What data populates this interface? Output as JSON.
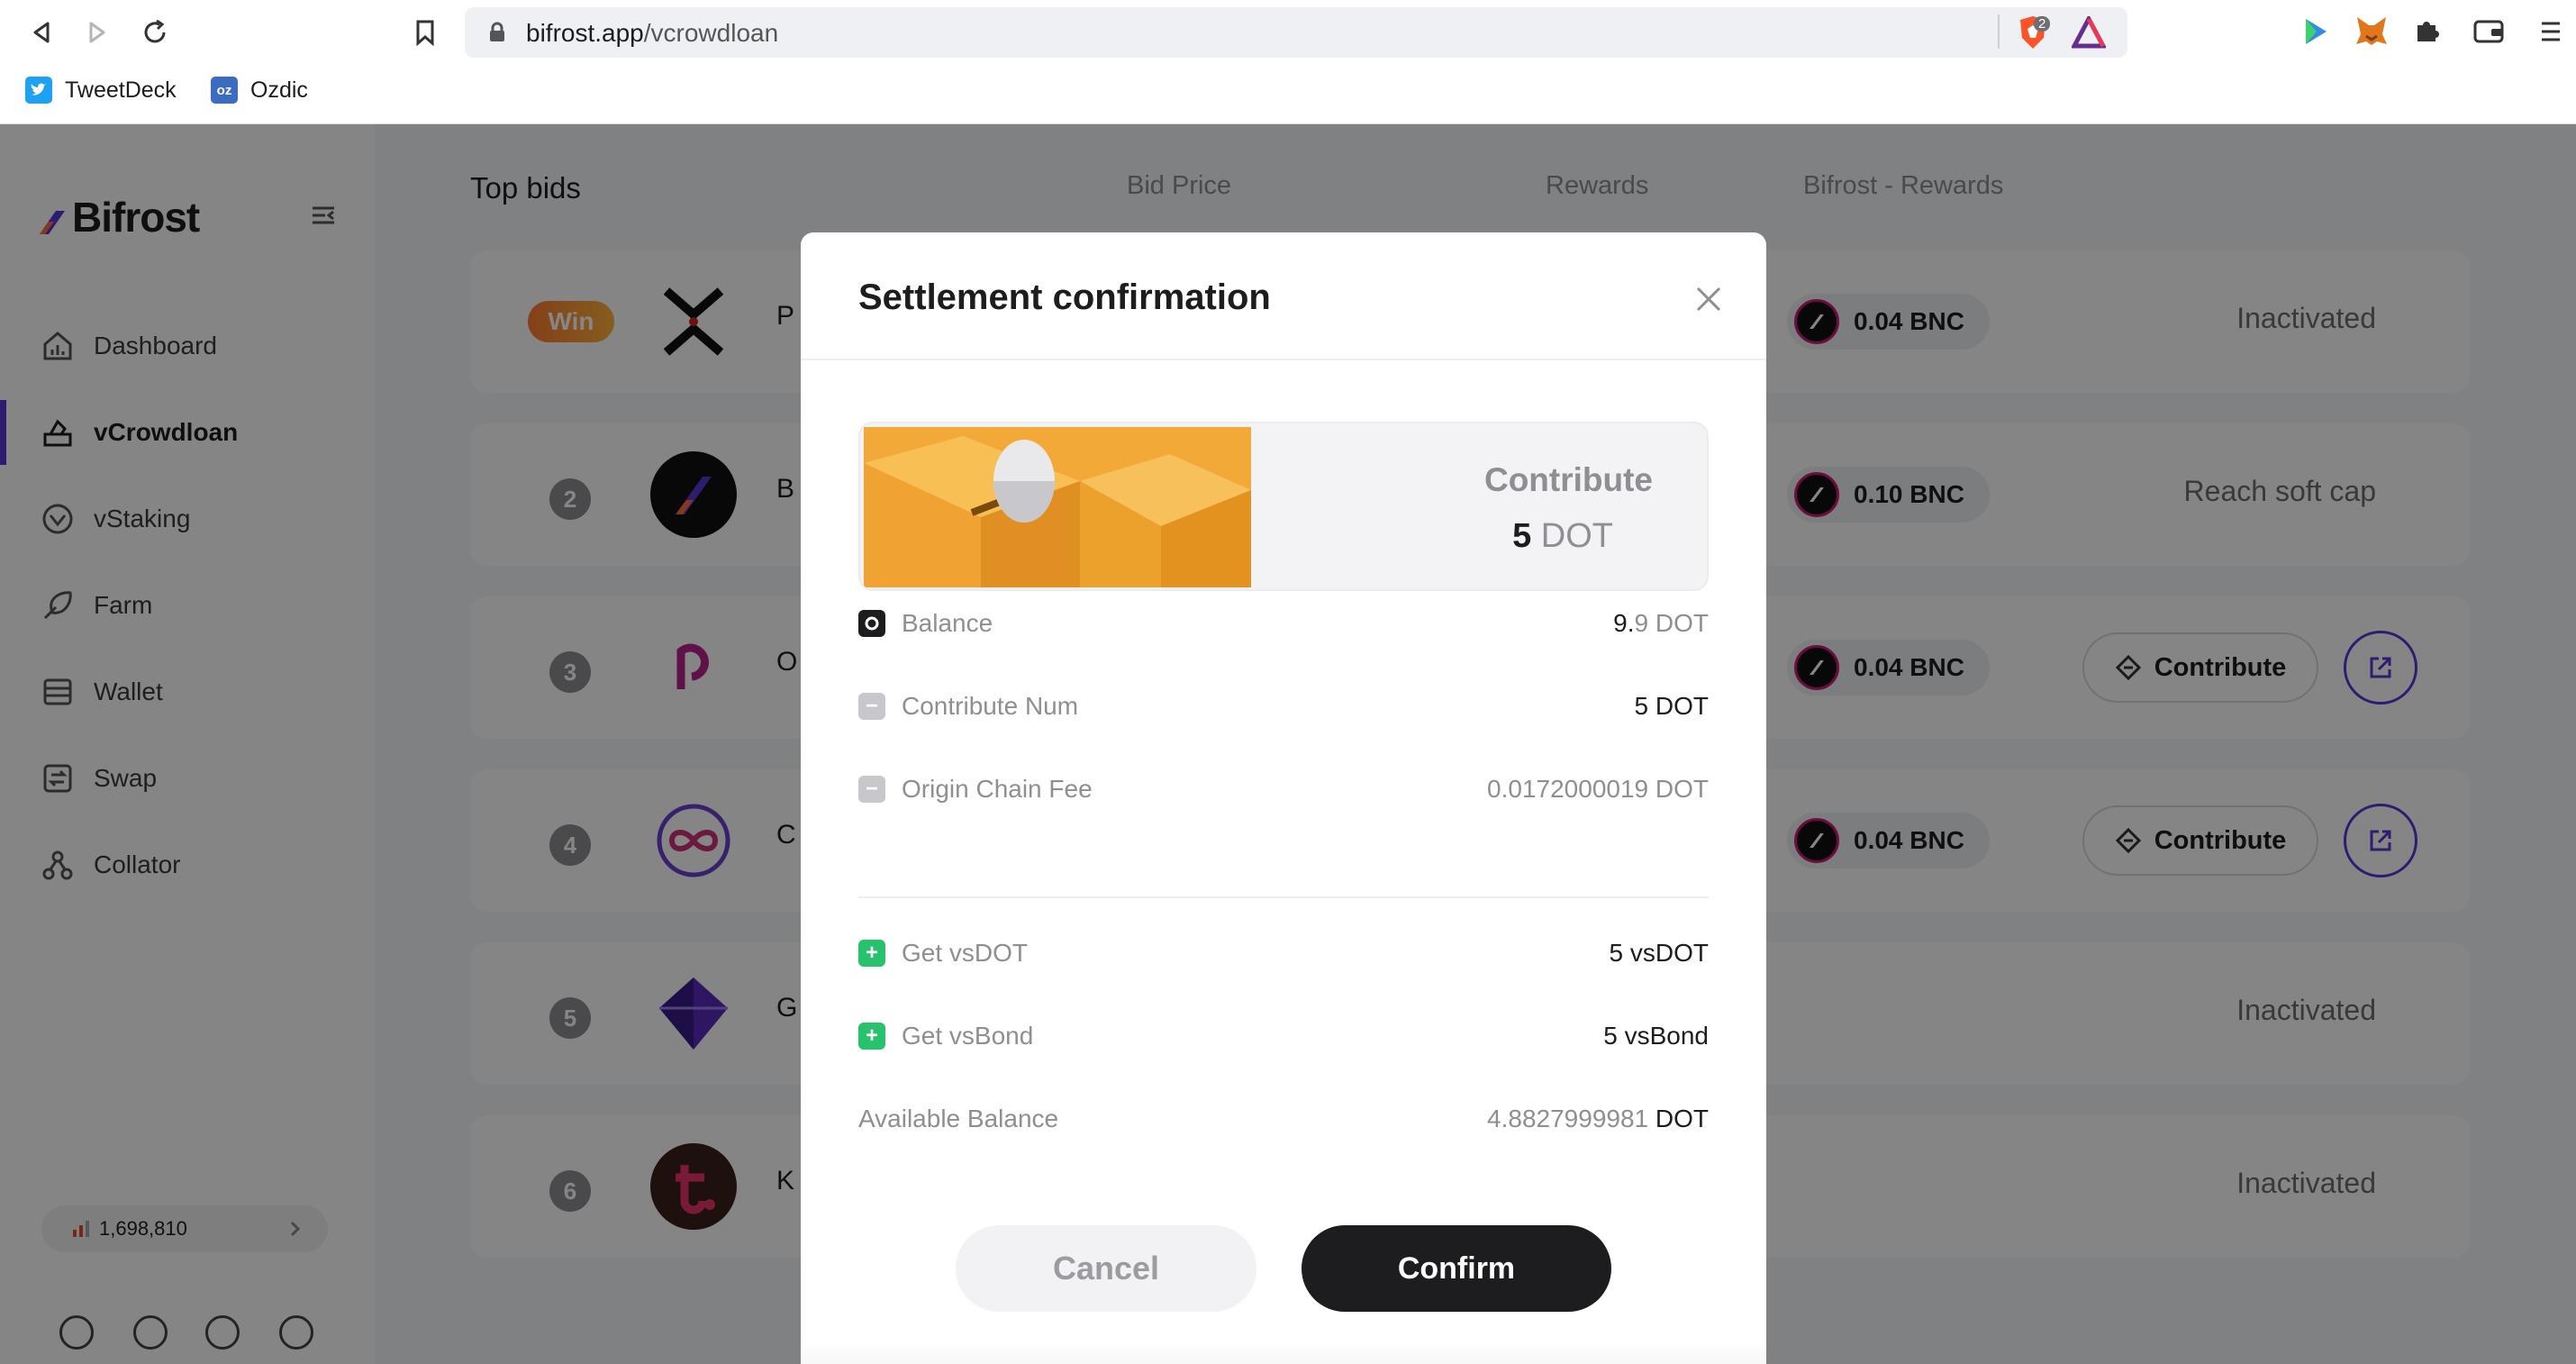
{
  "browser": {
    "url_host": "bifrost.app",
    "url_path": "/vcrowdloan",
    "shield_count": "2",
    "bookmarks": [
      {
        "label": "TweetDeck",
        "icon": "tweetdeck-icon",
        "color": "#1da1f2"
      },
      {
        "label": "Ozdic",
        "icon": "ozdic-icon",
        "color": "#3b6cc2",
        "badge": "oz"
      }
    ]
  },
  "sidebar": {
    "logo": "Bifrost",
    "items": [
      {
        "label": "Dashboard",
        "icon": "dashboard-icon"
      },
      {
        "label": "vCrowdloan",
        "icon": "vcrowdloan-icon",
        "active": true
      },
      {
        "label": "vStaking",
        "icon": "vstaking-icon"
      },
      {
        "label": "Farm",
        "icon": "farm-icon"
      },
      {
        "label": "Wallet",
        "icon": "wallet-icon"
      },
      {
        "label": "Swap",
        "icon": "swap-icon"
      },
      {
        "label": "Collator",
        "icon": "collator-icon"
      }
    ],
    "block_number": "1,698,810",
    "social": [
      "github-icon",
      "twitter-icon",
      "telegram-icon",
      "medium-icon"
    ]
  },
  "table": {
    "headers": [
      "Top bids",
      "Bid Price",
      "Rewards",
      "Bifrost - Rewards"
    ],
    "rows": [
      {
        "rank": "Win",
        "initial": "P",
        "logo_color": "#ffffff",
        "bnc": "0.04 BNC",
        "status": "Inactivated"
      },
      {
        "rank": "2",
        "initial": "B",
        "logo_color": "#111111",
        "bnc": "0.10 BNC",
        "status": "Reach soft cap"
      },
      {
        "rank": "3",
        "initial": "O",
        "logo_color": "#ffffff",
        "bnc": "0.04 BNC",
        "status": "",
        "contribute": "Contribute"
      },
      {
        "rank": "4",
        "initial": "C",
        "logo_color": "#ffffff",
        "bnc": "0.04 BNC",
        "status": "",
        "contribute": "Contribute"
      },
      {
        "rank": "5",
        "initial": "G",
        "logo_color": "#ffffff",
        "bnc": "",
        "status": "Inactivated"
      },
      {
        "rank": "6",
        "initial": "K",
        "logo_color": "#3a1f1a",
        "bnc": "",
        "status": "Inactivated"
      }
    ]
  },
  "modal": {
    "title": "Settlement confirmation",
    "banner": {
      "label": "Contribute",
      "amount": "5",
      "unit": "DOT"
    },
    "lines": [
      {
        "label": "Balance",
        "value_main": "9.",
        "value_rest": "9",
        "unit": "DOT",
        "icon": "circle"
      },
      {
        "label": "Contribute Num",
        "value_main": "5",
        "value_rest": "",
        "unit": "DOT",
        "icon": "minus"
      },
      {
        "label": "Origin Chain Fee",
        "value_main": "0.0172000019",
        "value_rest": "",
        "unit": "DOT",
        "icon": "minus"
      },
      {
        "label": "Get vsDOT",
        "value_main": "5",
        "value_rest": "",
        "unit": "vsDOT",
        "icon": "plus"
      },
      {
        "label": "Get vsBond",
        "value_main": "5",
        "value_rest": "",
        "unit": "vsBond",
        "icon": "plus"
      },
      {
        "label": "Available Balance",
        "value_main": "4.8827999981",
        "value_rest": "",
        "unit": "DOT",
        "icon": ""
      }
    ],
    "cancel": "Cancel",
    "confirm": "Confirm"
  },
  "colors": {
    "accent": "#5b35d5",
    "plus": "#27c26c",
    "minus": "#c7c7cc"
  }
}
